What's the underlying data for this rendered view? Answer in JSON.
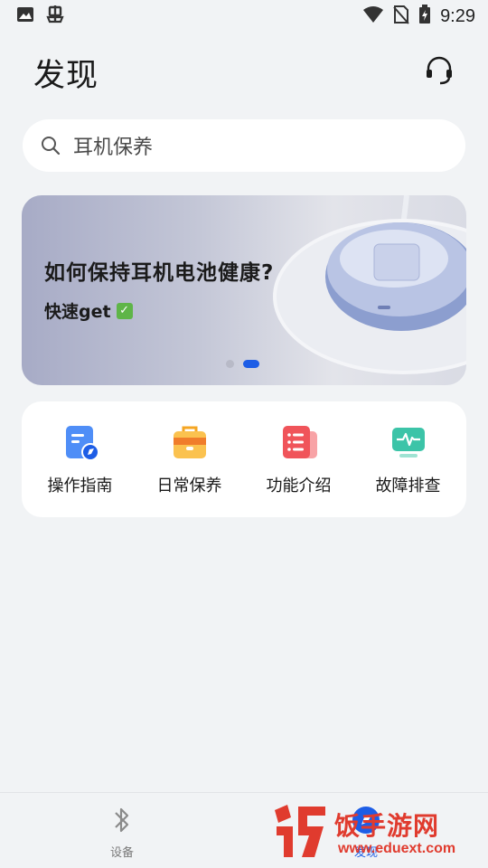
{
  "status_bar": {
    "time": "9:29",
    "icons": [
      "image-icon",
      "bug-icon",
      "wifi-icon",
      "no-sim-icon",
      "battery-charging-icon"
    ]
  },
  "header": {
    "title": "发现",
    "support_icon": "headset-icon"
  },
  "search": {
    "placeholder": "耳机保养",
    "icon": "search-icon"
  },
  "banner": {
    "title": "如何保持耳机电池健康?",
    "subtitle": "快速get",
    "badge": "✓",
    "page_count": 2,
    "active_page": 2
  },
  "quick_links": [
    {
      "label": "操作指南",
      "icon": "guide-icon",
      "color": "#4f8ef7"
    },
    {
      "label": "日常保养",
      "icon": "maintenance-bag-icon",
      "color": "#f5a623"
    },
    {
      "label": "功能介绍",
      "icon": "feature-list-icon",
      "color": "#f0545a"
    },
    {
      "label": "故障排查",
      "icon": "troubleshoot-monitor-icon",
      "color": "#3cc4a8"
    }
  ],
  "bottom_nav": [
    {
      "label": "设备",
      "icon": "bluetooth-icon"
    },
    {
      "label": "发现",
      "icon": "discover-icon",
      "active": true
    }
  ],
  "watermark": {
    "text": "饭手游网",
    "url": "www.eduext.com"
  },
  "colors": {
    "accent": "#1d5de6",
    "background": "#f1f3f5"
  }
}
